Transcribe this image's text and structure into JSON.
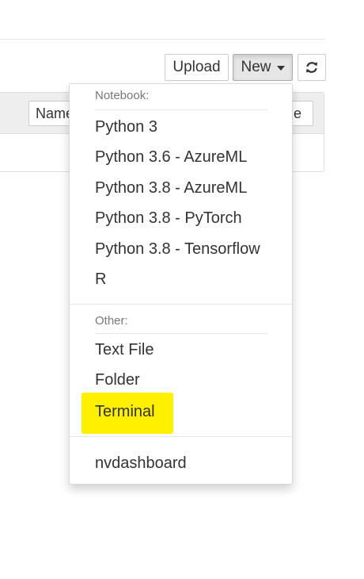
{
  "toolbar": {
    "upload_label": "Upload",
    "new_label": "New",
    "refresh_icon": "refresh-icon"
  },
  "list_header": {
    "name_label": "Name",
    "size_label": "ze"
  },
  "new_menu": {
    "notebook_header": "Notebook:",
    "notebook_items": [
      "Python 3",
      "Python 3.6 - AzureML",
      "Python 3.8 - AzureML",
      "Python 3.8 - PyTorch",
      "Python 3.8 - Tensorflow",
      "R"
    ],
    "other_header": "Other:",
    "other_items": [
      "Text File",
      "Folder",
      "Terminal"
    ],
    "extra_items": [
      "nvdashboard"
    ],
    "highlighted_item": "Terminal",
    "highlight_color": "#fff000"
  }
}
